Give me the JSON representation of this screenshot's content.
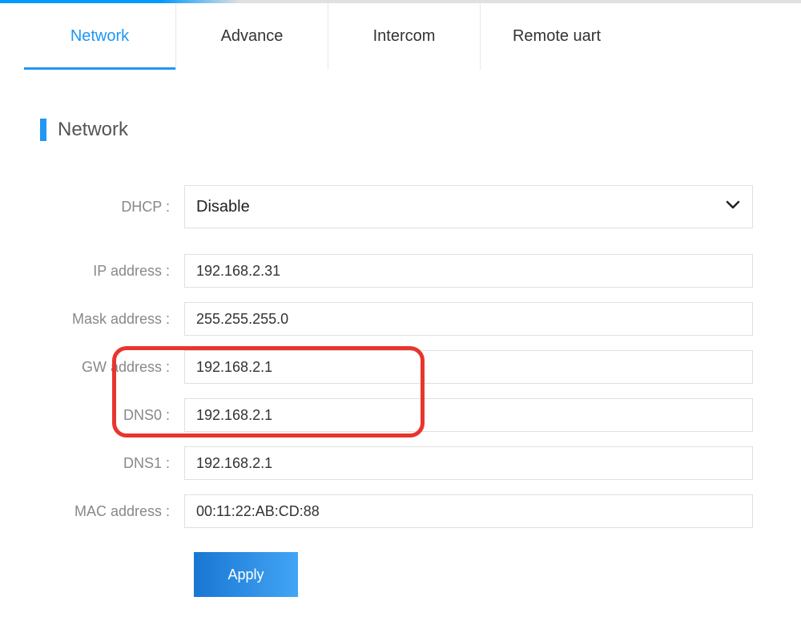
{
  "tabs": [
    {
      "label": "Network",
      "active": true
    },
    {
      "label": "Advance",
      "active": false
    },
    {
      "label": "Intercom",
      "active": false
    },
    {
      "label": "Remote uart",
      "active": false
    }
  ],
  "section": {
    "title": "Network"
  },
  "form": {
    "dhcp": {
      "label": "DHCP :",
      "value": "Disable"
    },
    "ip": {
      "label": "IP address :",
      "value": "192.168.2.31"
    },
    "mask": {
      "label": "Mask address :",
      "value": "255.255.255.0"
    },
    "gw": {
      "label": "GW address :",
      "value": "192.168.2.1"
    },
    "dns0": {
      "label": "DNS0 :",
      "value": "192.168.2.1"
    },
    "dns1": {
      "label": "DNS1 :",
      "value": "192.168.2.1"
    },
    "mac": {
      "label": "MAC address :",
      "value": "00:11:22:AB:CD:88"
    }
  },
  "buttons": {
    "apply": "Apply"
  }
}
